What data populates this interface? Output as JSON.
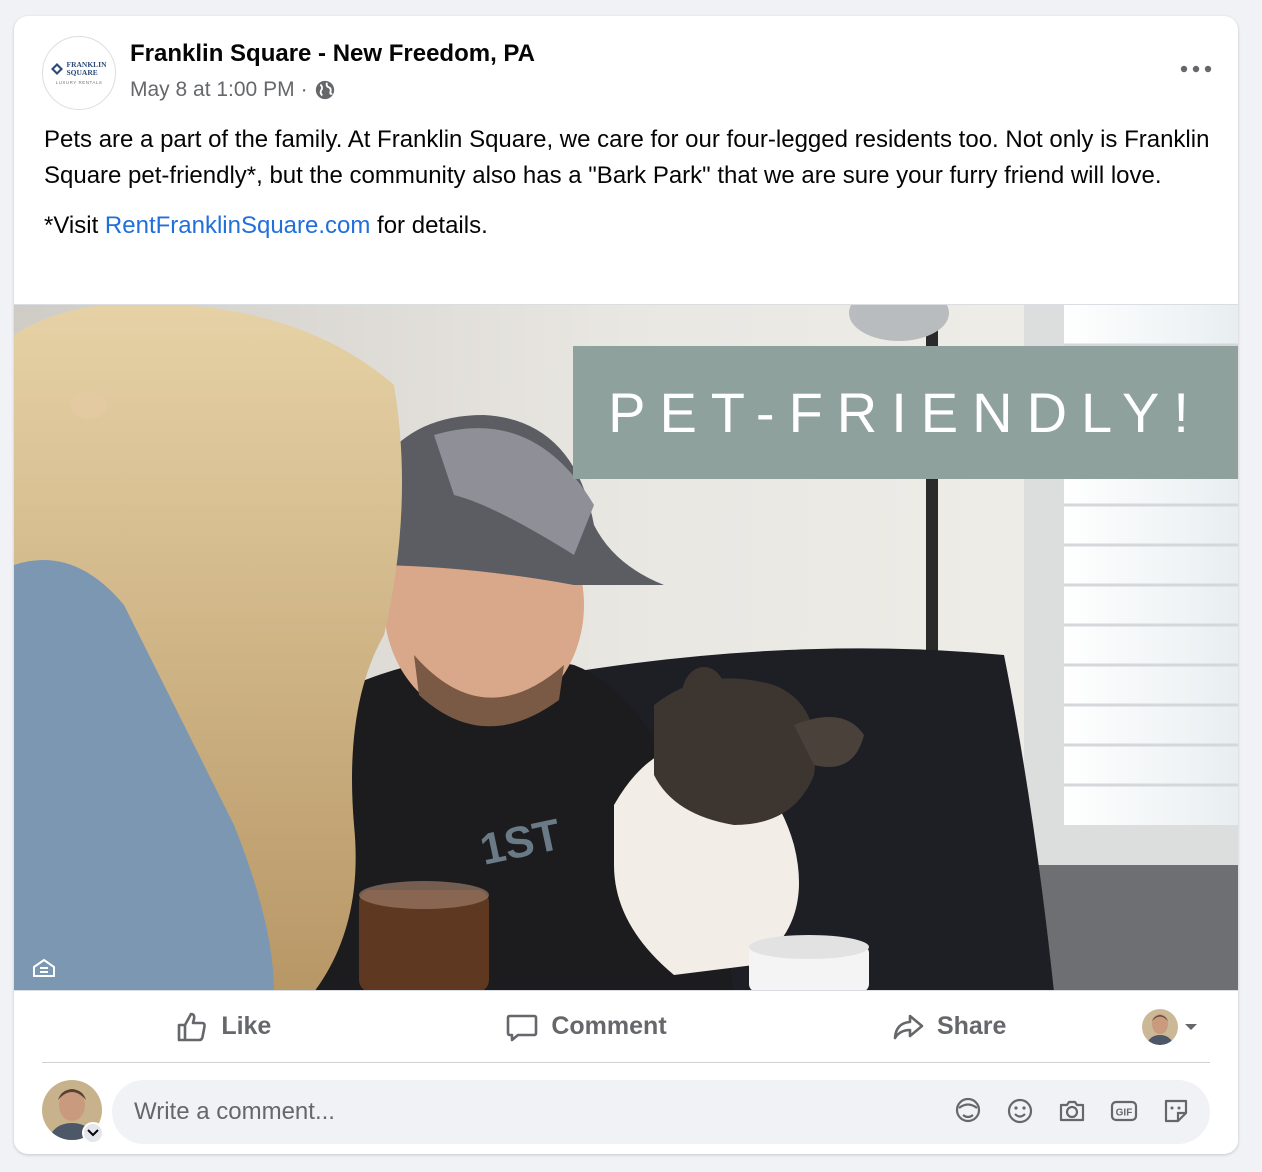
{
  "post": {
    "page_name": "Franklin Square - New Freedom, PA",
    "timestamp": "May 8 at 1:00 PM",
    "separator": "·",
    "logo": {
      "line1": "FRANKLIN",
      "line2": "SQUARE",
      "tagline": "LUXURY RENTALS"
    },
    "text_paragraph_1": "Pets are a part of the family. At Franklin Square, we care for our four-legged residents too. Not only is Franklin Square pet-friendly*, but the community also has a \"Bark Park\" that we are sure your furry friend will love.",
    "text_visit_prefix": "*Visit ",
    "text_visit_link": "RentFranklinSquare.com",
    "text_visit_suffix": " for details.",
    "image_banner": "PET-FRIENDLY!",
    "icons": {
      "more": "more-horizontal-icon",
      "audience": "globe-icon",
      "housing": "equal-housing-icon"
    }
  },
  "actions": {
    "like": "Like",
    "comment": "Comment",
    "share": "Share"
  },
  "comment_input": {
    "placeholder": "Write a comment..."
  },
  "colors": {
    "link": "#216fdb",
    "secondary_text": "#65676b",
    "banner": "#8fa19d"
  }
}
